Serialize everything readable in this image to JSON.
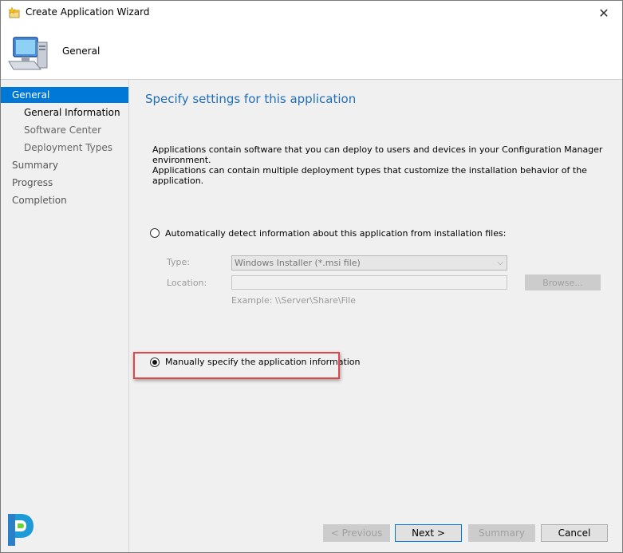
{
  "window": {
    "title": "Create Application Wizard",
    "close_glyph": "✕"
  },
  "header": {
    "title": "General"
  },
  "sidebar": {
    "items": [
      {
        "label": "General"
      },
      {
        "label": "General Information"
      },
      {
        "label": "Software Center"
      },
      {
        "label": "Deployment Types"
      },
      {
        "label": "Summary"
      },
      {
        "label": "Progress"
      },
      {
        "label": "Completion"
      }
    ]
  },
  "main": {
    "title": "Specify settings for this application",
    "intro_line1": "Applications contain software that you can deploy to users and devices in your Configuration Manager environment.",
    "intro_line2": "Applications can contain multiple deployment types that customize the installation behavior of the application.",
    "auto_detect": {
      "label": "Automatically detect information about this application from installation files:",
      "checked": false
    },
    "type_label": "Type:",
    "type_value": "Windows Installer (*.msi file)",
    "location_label": "Location:",
    "location_value": "",
    "browse_label": "Browse...",
    "example_text": "Example: \\\\Server\\Share\\File",
    "manual": {
      "label": "Manually specify the application information",
      "checked": true
    }
  },
  "footer": {
    "previous_label": "< Previous",
    "next_label": "Next >",
    "summary_label": "Summary",
    "cancel_label": "Cancel"
  },
  "colors": {
    "accent": "#0078d7",
    "title_blue": "#1f6fb8",
    "highlight_red": "#e0474c"
  },
  "icons": {
    "title": "wizard-star-icon",
    "header": "computer-monitor-icon",
    "logo": "brand-logo"
  }
}
